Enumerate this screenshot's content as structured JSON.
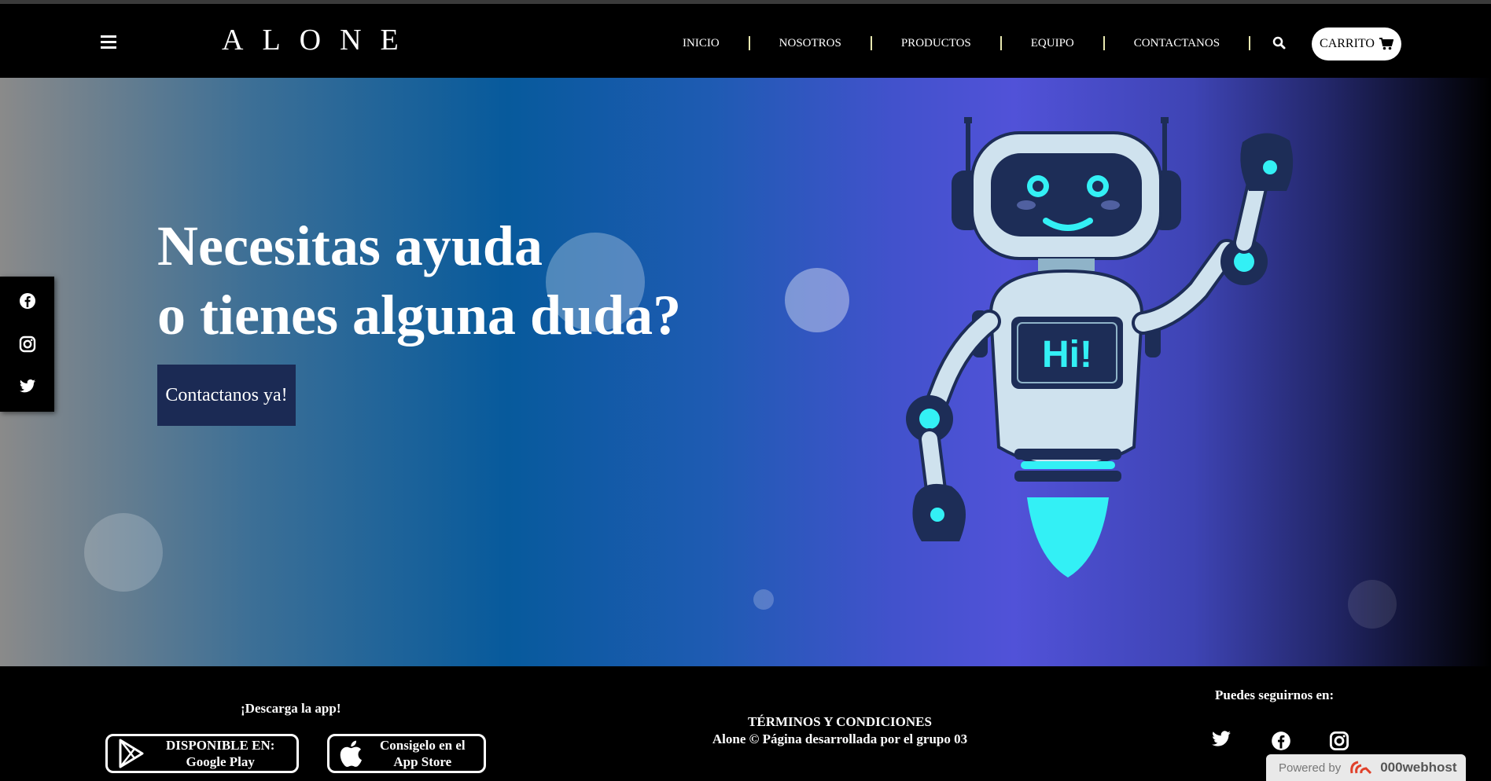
{
  "header": {
    "logo": "ALONE",
    "nav": [
      "INICIO",
      "NOSOTROS",
      "PRODUCTOS",
      "EQUIPO",
      "CONTACTANOS"
    ],
    "cart_label": "CARRITO"
  },
  "hero": {
    "title_line1": "Necesitas ayuda",
    "title_line2": "o tienes alguna duda?",
    "cta_label": "Contactanos ya!",
    "robot_badge": "Hi!"
  },
  "footer": {
    "download_title": "¡Descarga la app!",
    "google_play": {
      "line1": "DISPONIBLE EN:",
      "line2": "Google Play"
    },
    "app_store": {
      "line1": "Consigelo en el",
      "line2": "App Store"
    },
    "terms": "TÉRMINOS Y CONDICIONES",
    "credit": "Alone © Página desarrollada por el grupo 03",
    "follow_title": "Puedes seguirnos en:"
  },
  "powered": {
    "prefix": "Powered by",
    "brand": "000webhost"
  },
  "colors": {
    "cta_bg": "#1b2a54",
    "robot_accent": "#33f0f5",
    "robot_dark": "#1d2d57"
  }
}
